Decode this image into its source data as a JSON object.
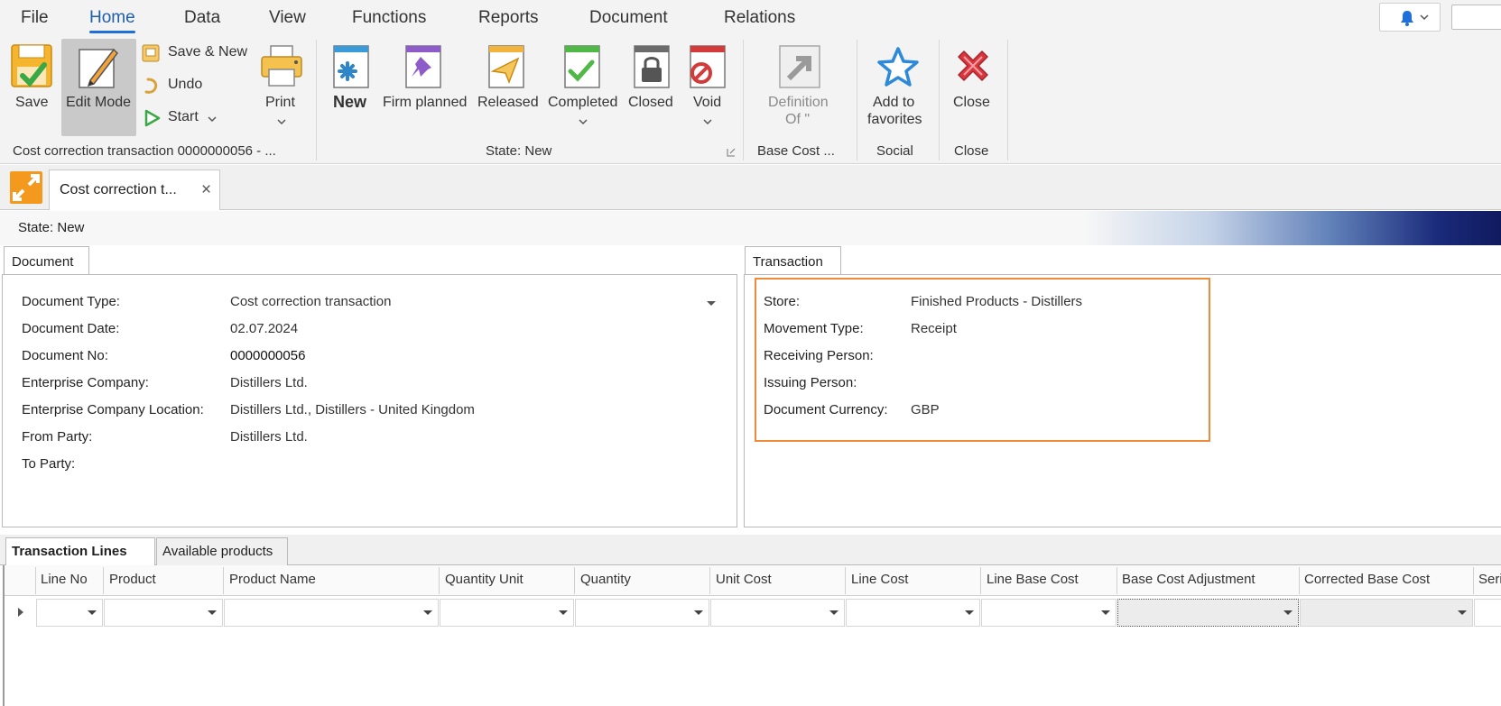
{
  "menubar": {
    "items": [
      "File",
      "Home",
      "Data",
      "View",
      "Functions",
      "Reports",
      "Document",
      "Relations"
    ],
    "active": "Home"
  },
  "ribbon": {
    "save": "Save",
    "edit_mode": "Edit Mode",
    "save_new": "Save & New",
    "undo": "Undo",
    "start": "Start",
    "print": "Print",
    "group_record": "Cost correction transaction 0000000056 - ...",
    "states": {
      "new": "New",
      "firm_planned": "Firm planned",
      "released": "Released",
      "completed": "Completed",
      "closed": "Closed",
      "void": "Void"
    },
    "group_state": "State: New",
    "definition_line1": "Definition",
    "definition_line2": "Of \"",
    "group_base_cost": "Base Cost ...",
    "add_fav_line1": "Add to",
    "add_fav_line2": "favorites",
    "group_social": "Social",
    "close": "Close",
    "group_close": "Close"
  },
  "doc_tab": {
    "title": "Cost correction t...",
    "close": "×"
  },
  "state_strip": {
    "text": "State: New"
  },
  "document_panel": {
    "tab": "Document",
    "fields": [
      {
        "label": "Document Type:",
        "value": "Cost correction transaction"
      },
      {
        "label": "Document Date:",
        "value": "02.07.2024"
      },
      {
        "label": "Document No:",
        "value": "0000000056"
      },
      {
        "label": "Enterprise Company:",
        "value": "Distillers Ltd."
      },
      {
        "label": "Enterprise Company Location:",
        "value": "Distillers Ltd., Distillers - United Kingdom"
      },
      {
        "label": "From Party:",
        "value": "Distillers Ltd."
      },
      {
        "label": "To Party:",
        "value": ""
      }
    ]
  },
  "transaction_panel": {
    "tab": "Transaction",
    "fields": [
      {
        "label": "Store:",
        "value": "Finished Products - Distillers"
      },
      {
        "label": "Movement Type:",
        "value": "Receipt"
      },
      {
        "label": "Receiving Person:",
        "value": ""
      },
      {
        "label": "Issuing Person:",
        "value": ""
      },
      {
        "label": "Document Currency:",
        "value": "GBP"
      }
    ]
  },
  "bottom_tabs": [
    "Transaction Lines",
    "Available products"
  ],
  "grid": {
    "columns": [
      "Line No",
      "Product",
      "Product Name",
      "Quantity Unit",
      "Quantity",
      "Unit Cost",
      "Line Cost",
      "Line Base Cost",
      "Base Cost Adjustment",
      "Corrected Base Cost",
      "Seri"
    ]
  },
  "colors": {
    "accent_blue": "#1e6fd9",
    "highlight_orange": "#ef8a3a",
    "close_red": "#d9363e",
    "favorite_blue": "#2e8ad8"
  }
}
